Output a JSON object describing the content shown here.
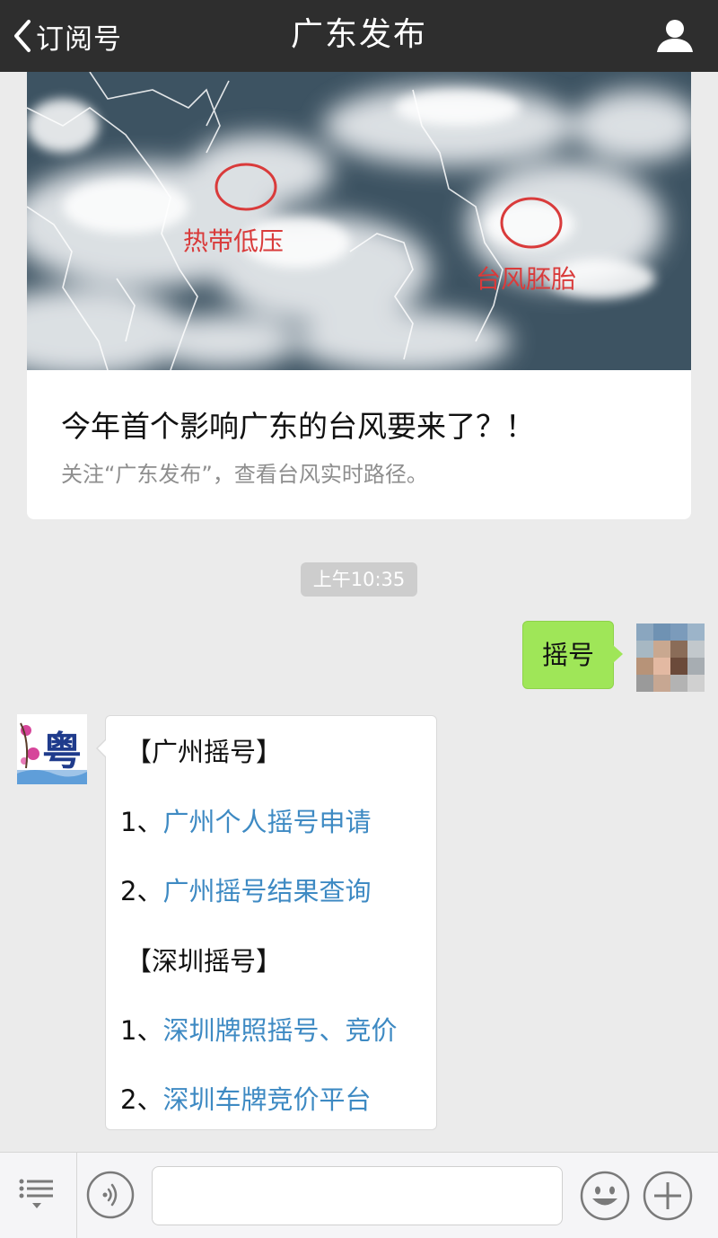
{
  "topbar": {
    "back_label": "订阅号",
    "title": "广东发布",
    "back_icon": "chevron-left-icon",
    "profile_icon": "user-icon"
  },
  "article": {
    "title": "今年首个影响广东的台风要来了？！",
    "description": "关注“广东发布”，查看台风实时路径。",
    "image_annotations": [
      "热带低压",
      "台风胚胎"
    ]
  },
  "timestamp": "上午10:35",
  "sent_message": {
    "text": "摇号"
  },
  "received_message": {
    "lines": [
      {
        "prefix": "【广州摇号】",
        "link": ""
      },
      {
        "prefix": "1、",
        "link": "广州个人摇号申请"
      },
      {
        "prefix": "2、",
        "link": "广州摇号结果查询"
      },
      {
        "prefix": "【深圳摇号】",
        "link": ""
      },
      {
        "prefix": "1、",
        "link": "深圳牌照摇号、竞价"
      },
      {
        "prefix": "2、",
        "link": "深圳车牌竞价平台"
      }
    ],
    "avatar_glyph": "粤"
  },
  "inputbar": {
    "menu_icon": "menu-list-icon",
    "voice_icon": "voice-icon",
    "emoji_icon": "emoji-icon",
    "plus_icon": "plus-icon",
    "input_value": ""
  },
  "colors": {
    "topbar_bg": "#2e2e2e",
    "page_bg": "#ebebeb",
    "sent_bubble": "#9fe658",
    "link": "#3e8ac3",
    "annotation": "#d93b3b"
  }
}
